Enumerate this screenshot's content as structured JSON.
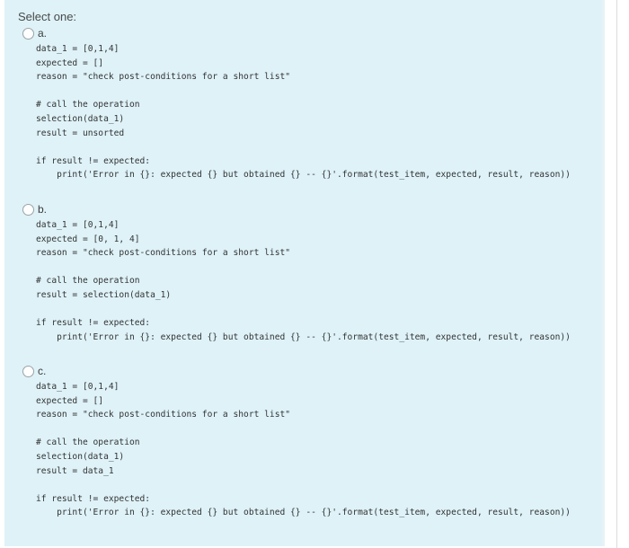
{
  "prompt": "Select one:",
  "options": [
    {
      "letter": "a.",
      "lines": [
        "data_1 = [0,1,4]",
        "expected = []",
        "reason = \"check post-conditions for a short list\"",
        "",
        "# call the operation",
        "selection(data_1)",
        "result = unsorted",
        "",
        "if result != expected:",
        "    print('Error in {}: expected {} but obtained {} -- {}'.format(test_item, expected, result, reason))"
      ]
    },
    {
      "letter": "b.",
      "lines": [
        "data_1 = [0,1,4]",
        "expected = [0, 1, 4]",
        "reason = \"check post-conditions for a short list\"",
        "",
        "# call the operation",
        "result = selection(data_1)",
        "",
        "if result != expected:",
        "    print('Error in {}: expected {} but obtained {} -- {}'.format(test_item, expected, result, reason))"
      ]
    },
    {
      "letter": "c.",
      "lines": [
        "data_1 = [0,1,4]",
        "expected = []",
        "reason = \"check post-conditions for a short list\"",
        "",
        "# call the operation",
        "selection(data_1)",
        "result = data_1",
        "",
        "if result != expected:",
        "    print('Error in {}: expected {} but obtained {} -- {}'.format(test_item, expected, result, reason))"
      ]
    }
  ]
}
